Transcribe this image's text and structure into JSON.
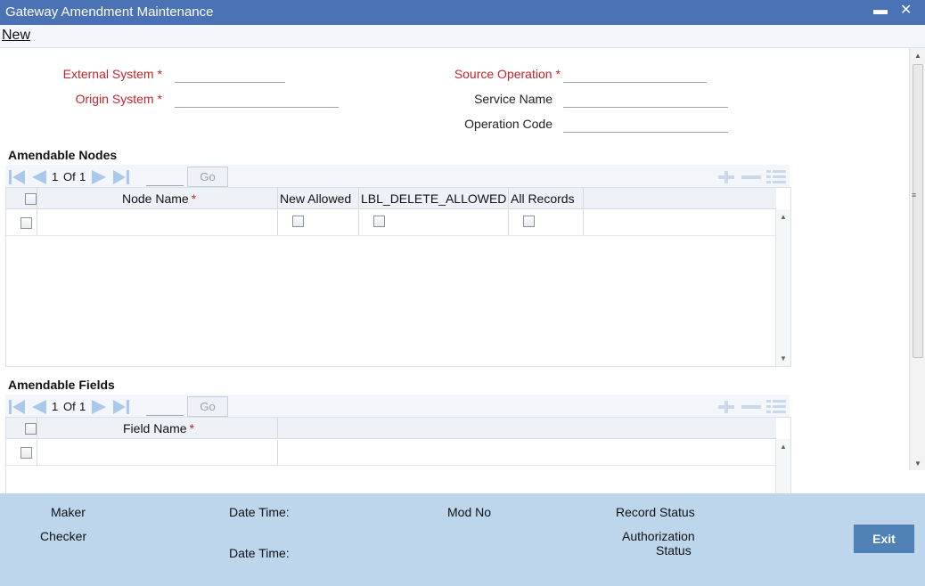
{
  "window": {
    "title": "Gateway Amendment Maintenance",
    "minimize_glyph": "▬",
    "close_glyph": "✕"
  },
  "menu": {
    "new_label": "New"
  },
  "form": {
    "external_system": {
      "label": "External System",
      "value": ""
    },
    "origin_system": {
      "label": "Origin System",
      "value": ""
    },
    "source_operation": {
      "label": "Source Operation",
      "value": ""
    },
    "service_name": {
      "label": "Service Name",
      "value": ""
    },
    "operation_code": {
      "label": "Operation Code",
      "value": ""
    },
    "required_mark": "*"
  },
  "nodes": {
    "title": "Amendable Nodes",
    "pager": {
      "current": "1",
      "of": "Of",
      "total": "1",
      "go_label": "Go"
    },
    "columns": [
      "Node Name",
      "New Allowed",
      "LBL_DELETE_ALLOWED",
      "All Records"
    ]
  },
  "fields": {
    "title": "Amendable Fields",
    "pager": {
      "current": "1",
      "of": "Of",
      "total": "1",
      "go_label": "Go"
    },
    "columns": [
      "Field Name"
    ]
  },
  "footer": {
    "maker": "Maker",
    "checker": "Checker",
    "date_time": "Date Time:",
    "mod_no": "Mod No",
    "record_status": "Record Status",
    "authorization": "Authorization",
    "status": "Status",
    "exit_label": "Exit"
  },
  "colors": {
    "titlebar": "#4a72b4",
    "required": "#c0262b",
    "footer": "#bdd6ec",
    "exit_button": "#4f81b7",
    "nav_icon": "#aac8ec"
  }
}
